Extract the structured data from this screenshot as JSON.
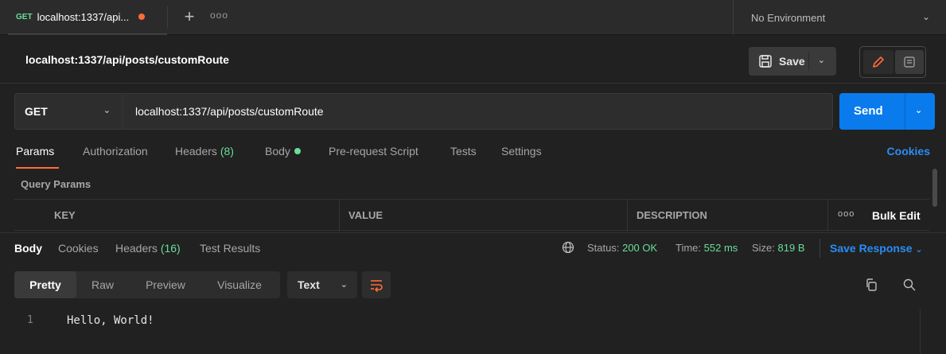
{
  "tabbar": {
    "active_tab": {
      "method": "GET",
      "title": "localhost:1337/api...",
      "unsaved": true
    },
    "new_tab_icon": "plus-icon",
    "more_icon": "more-horizontal-icon",
    "environment": "No Environment"
  },
  "request": {
    "title": "localhost:1337/api/posts/customRoute",
    "save_label": "Save",
    "method": "GET",
    "url": "localhost:1337/api/posts/customRoute",
    "send_label": "Send"
  },
  "request_tabs": {
    "params": "Params",
    "authorization": "Authorization",
    "headers": "Headers",
    "headers_count": "(8)",
    "body": "Body",
    "prerequest": "Pre-request Script",
    "tests": "Tests",
    "settings": "Settings",
    "cookies": "Cookies"
  },
  "params": {
    "section_label": "Query Params",
    "columns": [
      "KEY",
      "VALUE",
      "DESCRIPTION"
    ],
    "bulk_edit": "Bulk Edit"
  },
  "response": {
    "tabs": {
      "body": "Body",
      "cookies": "Cookies",
      "headers": "Headers",
      "headers_count": "(16)",
      "test_results": "Test Results"
    },
    "status_label": "Status:",
    "status_value": "200 OK",
    "time_label": "Time:",
    "time_value": "552 ms",
    "size_label": "Size:",
    "size_value": "819 B",
    "save_response": "Save Response",
    "formats": [
      "Pretty",
      "Raw",
      "Preview",
      "Visualize"
    ],
    "type": "Text",
    "lines": [
      {
        "number": "1",
        "text": "Hello, World!"
      }
    ]
  },
  "colors": {
    "accent": "#ff6c37",
    "primary": "#097bed",
    "link": "#2b8cf5",
    "success": "#6bdd9a",
    "background": "#212121"
  }
}
